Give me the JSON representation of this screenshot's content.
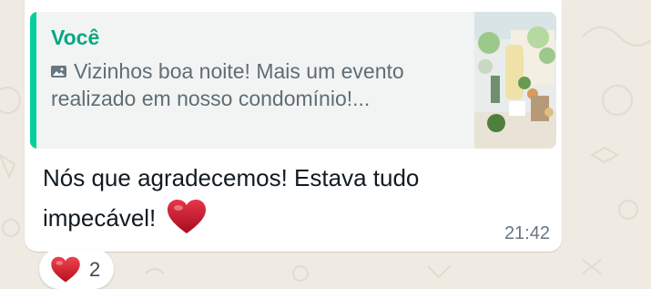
{
  "message": {
    "quote": {
      "author": "Você",
      "text": "Vizinhos boa noite! Mais um evento realizado em nosso condomínio!...",
      "media_icon": "photo-icon"
    },
    "body": "Nós que agradecemos! Estava tudo impecável!",
    "emoji": "heart-icon",
    "time": "21:42"
  },
  "reaction": {
    "emoji": "heart-icon",
    "count": "2"
  },
  "colors": {
    "background": "#efeae2",
    "bubble": "#ffffff",
    "quote_bar": "#06cf9c",
    "quote_author": "#06a884",
    "heart": "#c8102e"
  }
}
